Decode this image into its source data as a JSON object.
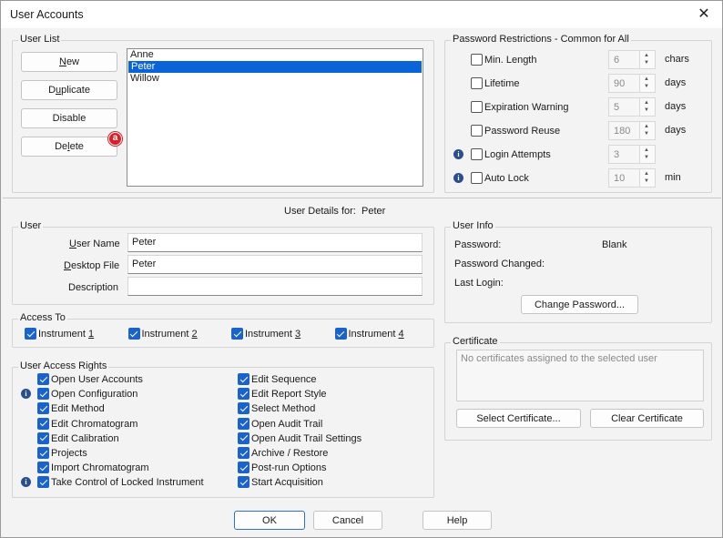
{
  "window": {
    "title": "User Accounts",
    "close": "✕"
  },
  "user_list": {
    "legend": "User List",
    "buttons": {
      "new_pre": "",
      "new_u": "N",
      "new_post": "ew",
      "duplicate_pre": "D",
      "duplicate_u": "u",
      "duplicate_post": "plicate",
      "disable": "Disable",
      "delete_pre": "De",
      "delete_u": "l",
      "delete_post": "ete"
    },
    "users": [
      "Anne",
      "Peter",
      "Willow"
    ],
    "selected": "Peter",
    "badge": "a"
  },
  "password_restrictions": {
    "legend": "Password Restrictions - Common for All",
    "rows": [
      {
        "label": "Min. Length",
        "value": "6",
        "unit": "chars",
        "checked": false,
        "info": false
      },
      {
        "label": "Lifetime",
        "value": "90",
        "unit": "days",
        "checked": false,
        "info": false
      },
      {
        "label": "Expiration Warning",
        "value": "5",
        "unit": "days",
        "checked": false,
        "info": false
      },
      {
        "label": "Password Reuse",
        "value": "180",
        "unit": "days",
        "checked": false,
        "info": false
      },
      {
        "label": "Login Attempts",
        "value": "3",
        "unit": "",
        "checked": false,
        "info": true
      },
      {
        "label": "Auto Lock",
        "value": "10",
        "unit": "min",
        "checked": false,
        "info": true
      }
    ]
  },
  "details_header": {
    "label": "User Details for:",
    "user": "Peter"
  },
  "user": {
    "legend": "User",
    "user_name_label_u": "U",
    "user_name_label": "ser Name",
    "user_name": "Peter",
    "desktop_label_u": "D",
    "desktop_label": "esktop File",
    "desktop_file": "Peter",
    "description_label": "Description",
    "description": ""
  },
  "user_info": {
    "legend": "User Info",
    "password_label": "Password:",
    "password_value": "Blank",
    "changed_label": "Password Changed:",
    "changed_value": "",
    "login_label": "Last Login:",
    "login_value": "",
    "change_button": "Change Password..."
  },
  "access_to": {
    "legend": "Access To",
    "instruments": [
      {
        "label": "Instrument ",
        "num": "1",
        "checked": true
      },
      {
        "label": "Instrument ",
        "num": "2",
        "checked": true
      },
      {
        "label": "Instrument ",
        "num": "3",
        "checked": true
      },
      {
        "label": "Instrument ",
        "num": "4",
        "checked": true
      }
    ]
  },
  "certificate": {
    "legend": "Certificate",
    "empty_text": "No certificates assigned to the selected user",
    "select_button": "Select Certificate...",
    "clear_button": "Clear Certificate"
  },
  "rights": {
    "legend": "User Access Rights",
    "left": [
      {
        "label": "Open User Accounts",
        "info": false
      },
      {
        "label": "Open Configuration",
        "info": true
      },
      {
        "label": "Edit Method",
        "info": false
      },
      {
        "label": "Edit Chromatogram",
        "info": false
      },
      {
        "label": "Edit Calibration",
        "info": false
      },
      {
        "label": "Projects",
        "info": false
      },
      {
        "label": "Import Chromatogram",
        "info": false
      },
      {
        "label": "Take Control of Locked Instrument",
        "info": true
      }
    ],
    "right": [
      {
        "label": "Edit Sequence"
      },
      {
        "label": "Edit Report Style"
      },
      {
        "label": "Select Method"
      },
      {
        "label": "Open Audit Trail"
      },
      {
        "label": "Open Audit Trail Settings"
      },
      {
        "label": "Archive / Restore"
      },
      {
        "label": "Post-run Options"
      },
      {
        "label": "Start Acquisition"
      }
    ]
  },
  "footer": {
    "ok": "OK",
    "cancel": "Cancel",
    "help": "Help"
  }
}
